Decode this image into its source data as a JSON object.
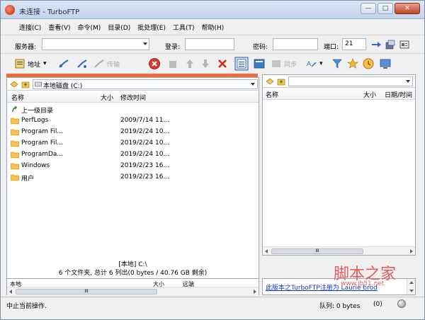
{
  "window": {
    "title": "未连接 - TurboFTP",
    "min": "—",
    "max": "□",
    "close": "✕"
  },
  "menu": [
    "连接(C)",
    "查看(V)",
    "命令(M)",
    "目录(D)",
    "批处理(E)",
    "工具(T)",
    "帮助(H)"
  ],
  "connection": {
    "server_label": "服务器:",
    "login_label": "登录:",
    "password_label": "密码:",
    "port_label": "端口:",
    "port_value": "21"
  },
  "toolbar": {
    "address": "地址",
    "transfer": "传输",
    "sync": "同步"
  },
  "left_panel": {
    "path": "本地磁盘 (C:)",
    "columns": {
      "name": "名称",
      "size": "大小",
      "modified": "修改时间"
    },
    "rows": [
      {
        "name": "上一级目录",
        "date": "",
        "type": "up"
      },
      {
        "name": "PerfLogs",
        "date": "2009/7/14 11...",
        "type": "folder"
      },
      {
        "name": "Program Fil...",
        "date": "2019/2/24 10...",
        "type": "folder"
      },
      {
        "name": "Program Fil...",
        "date": "2019/2/24 10...",
        "type": "folder"
      },
      {
        "name": "ProgramDa...",
        "date": "2019/2/24 10...",
        "type": "folder"
      },
      {
        "name": "Windows",
        "date": "2019/2/23 16...",
        "type": "folder"
      },
      {
        "name": "用户",
        "date": "2019/2/23 16...",
        "type": "folder"
      }
    ],
    "summary_line1": "[本地] C:\\",
    "summary_line2": "6 个文件夹, 总计 6 列出(0 bytes / 40.76 GB 剩余)",
    "scroll_grip": "III"
  },
  "right_panel": {
    "columns": {
      "name": "名称",
      "size": "大小",
      "date": "日期/时间"
    },
    "scroll_grip": "III"
  },
  "log": {
    "left_columns": {
      "local": "本地",
      "size": "大小",
      "path": "远端"
    },
    "right_link": "此版本之TurboFTP注册为 Laurie brod"
  },
  "status": {
    "text": "中止当前操作.",
    "queue": "队列: 0 bytes",
    "count": "(0)"
  },
  "watermark": {
    "main": "脚本之家",
    "sub": "www.jb51.net"
  }
}
